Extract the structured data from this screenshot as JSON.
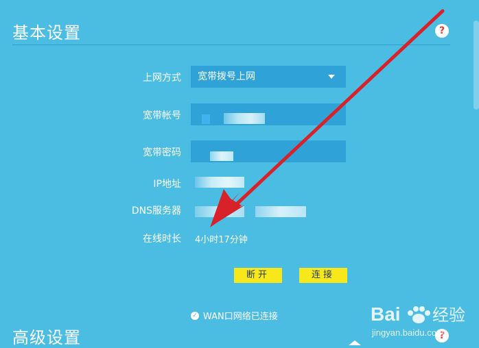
{
  "basic": {
    "title": "基本设置",
    "help": "?",
    "fields": {
      "connection_type_label": "上网方式",
      "connection_type_value": "宽带拨号上网",
      "account_label": "宽带帐号",
      "password_label": "宽带密码",
      "ip_label": "IP地址",
      "dns_label": "DNS服务器",
      "online_time_label": "在线时长",
      "online_time_value": "4小时17分钟"
    },
    "buttons": {
      "disconnect": "断开",
      "connect": "连接"
    },
    "status": "WAN口网络已连接"
  },
  "advanced": {
    "title": "高级设置",
    "help": "?"
  },
  "watermark": {
    "brand": "Bai",
    "brand_cn": "经验",
    "url": "jingyan.baidu.com"
  },
  "colors": {
    "background": "#4bbde3",
    "input": "#2fa3d8",
    "button": "#f7e81c",
    "arrow": "#d8222a"
  }
}
